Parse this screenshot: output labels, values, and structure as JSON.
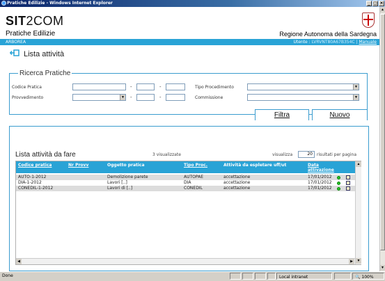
{
  "window": {
    "title": "Pratiche Edilizie - Windows Internet Explorer",
    "min": "_",
    "max": "□",
    "close": "×"
  },
  "header": {
    "logo_bold": "SIT",
    "logo_light": "2COM",
    "app_title": "Pratiche Edilizie",
    "region": "Regione Autonoma della Sardegna",
    "comune": "ARBOREA",
    "user_label": "Utente :",
    "user_value": "LVRVNT80A67B354C",
    "separator": "|",
    "manual": "Manuale"
  },
  "page_title": "Lista attività",
  "search": {
    "legend": "Ricerca Pratiche",
    "codice_label": "Codice Pratica",
    "provvedimento_label": "Provvedimento",
    "tipo_label": "Tipo Procedimento",
    "commissione_label": "Commissione",
    "dash": "-",
    "filter_button": "Filtra",
    "new_button": "Nuovo"
  },
  "list": {
    "title": "Lista attività da fare",
    "count_text": "3 visualizzate",
    "show_label": "visualizza",
    "per_page": "20",
    "per_page_suffix": "risultati per pagina",
    "columns": [
      "Codice pratica",
      "Nr Provv",
      "Oggetto pratica",
      "Tipo Proc.",
      "Attività da espletare uff/ut",
      "Data",
      "attivazione"
    ],
    "rows": [
      {
        "codice": "AUTO-1-2012",
        "nr": "",
        "oggetto": "Demolizione parete",
        "tipo": "AUTOPAE",
        "attivita": "accettazione",
        "data": "17/01/2012"
      },
      {
        "codice": "DIA-1-2012",
        "nr": "",
        "oggetto": "Lavori [..]",
        "tipo": "DIA",
        "attivita": "accettazione",
        "data": "17/01/2012"
      },
      {
        "codice": "CONEDIL-1-2012",
        "nr": "",
        "oggetto": "Lavori di [..]",
        "tipo": "CONEDIL",
        "attivita": "accettazione",
        "data": "17/01/2012"
      }
    ]
  },
  "status": {
    "left": "Done",
    "zone": "Local intranet",
    "zoom": "100%"
  },
  "colors": {
    "accent": "#29a3d6",
    "border": "#3a9ccf",
    "status_ok": "#2bbf2b"
  }
}
